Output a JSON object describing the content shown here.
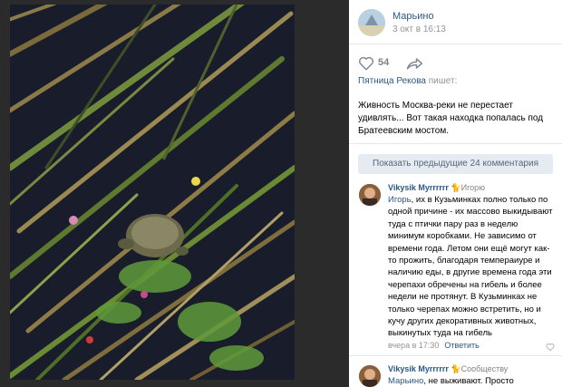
{
  "post": {
    "author": "Марьино",
    "date": "3 окт в 16:13",
    "likes": "54",
    "repost_author": "Пятница Рекова",
    "repost_suffix": " пишет:",
    "text": "Живность Москва-реки не перестает удивлять... Вот такая находка попалась под Братеевским мостом."
  },
  "comments_bar": {
    "show_previous": "Показать предыдущие 24 комментария"
  },
  "comments": [
    {
      "author": "Vikysik Myrrrrrr",
      "via": "Игорю",
      "addressee": "Игорь",
      "text": ", их в Кузьминках полно только по одной причине - их массово выкидывают туда с птички пару раз в неделю минимум коробками. Не зависимо от времени года. Летом они ещё могут как-то прожить, благодаря темпераиуре и наличию еды, в другие времена года эти черепахи обречены на гибель и более недели не протянут. В Кузьминках не только черепах можно встретить, но и кучу других декоративных животных, выкинутых туда на гибель",
      "time": "вчера в 17:30",
      "reply": "Ответить"
    },
    {
      "author": "Vikysik Myrrrrrr",
      "via": "Сообществу",
      "addressee": "Марьино",
      "text": ", не выживают. Просто"
    }
  ],
  "colors": {
    "link": "#2a5885",
    "muted": "#939393",
    "button_bg": "#e5ebf1"
  },
  "icons": [
    "like-icon",
    "share-icon",
    "cat-emoji-icon",
    "heart-icon"
  ]
}
